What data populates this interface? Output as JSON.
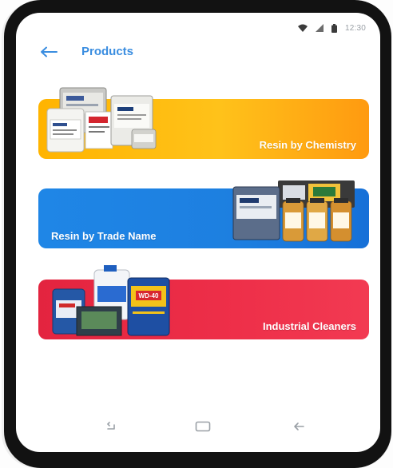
{
  "status_bar": {
    "time": "12:30",
    "icons": [
      "wifi-icon",
      "signal-icon",
      "battery-icon"
    ]
  },
  "app_bar": {
    "back_icon": "arrow-left-icon",
    "title": "Products"
  },
  "categories": [
    {
      "label": "Resin by Chemistry",
      "image": "resin-containers-image",
      "color": "#FFB400"
    },
    {
      "label": "Resin by Trade Name",
      "image": "resin-bottles-image",
      "color": "#1F86E6"
    },
    {
      "label": "Industrial Cleaners",
      "image": "cleaner-products-image",
      "color": "#E3243F"
    }
  ],
  "nav_bar": {
    "recents": "recents-icon",
    "home": "home-icon",
    "back": "back-icon"
  },
  "colors": {
    "accent": "#3A8DE0",
    "device_frame": "#121212"
  }
}
